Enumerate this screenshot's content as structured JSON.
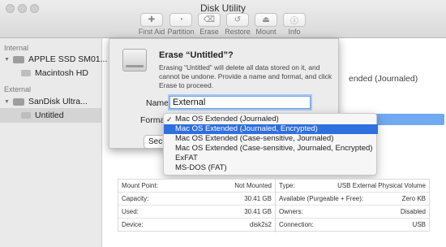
{
  "window": {
    "title": "Disk Utility"
  },
  "toolbar": [
    {
      "label": "First Aid",
      "icon": "first-aid-icon",
      "glyph": "✚"
    },
    {
      "label": "Partition",
      "icon": "partition-icon",
      "glyph": "◔"
    },
    {
      "label": "Erase",
      "icon": "erase-icon",
      "glyph": "⌫"
    },
    {
      "label": "Restore",
      "icon": "restore-icon",
      "glyph": "↺"
    },
    {
      "label": "Mount",
      "icon": "mount-icon",
      "glyph": "⏏"
    },
    {
      "label": "Info",
      "icon": "info-icon",
      "glyph": "ⓘ"
    }
  ],
  "sidebar": {
    "internal_header": "Internal",
    "external_header": "External",
    "items": [
      {
        "label": "APPLE SSD SM01..."
      },
      {
        "label": "Macintosh HD"
      },
      {
        "label": "SanDisk Ultra..."
      },
      {
        "label": "Untitled"
      }
    ]
  },
  "main": {
    "format_text": "ended (Journaled)"
  },
  "sheet": {
    "title": "Erase “Untitled”?",
    "message": "Erasing “Untitled” will delete all data stored on it, and cannot be undone. Provide a name and format, and click Erase to proceed.",
    "name_label": "Name:",
    "name_value": "External",
    "format_label": "Format",
    "security_button": "Security Options..."
  },
  "format_menu": {
    "options": [
      "Mac OS Extended (Journaled)",
      "Mac OS Extended (Journaled, Encrypted)",
      "Mac OS Extended (Case-sensitive, Journaled)",
      "Mac OS Extended (Case-sensitive, Journaled, Encrypted)",
      "ExFAT",
      "MS-DOS (FAT)"
    ],
    "checked": "✓",
    "accent": "#2f6fde"
  },
  "info": {
    "left": [
      {
        "label": "Mount Point:",
        "value": "Not Mounted"
      },
      {
        "label": "Capacity:",
        "value": "30.41 GB"
      },
      {
        "label": "Used:",
        "value": "30.41 GB"
      },
      {
        "label": "Device:",
        "value": "disk2s2"
      }
    ],
    "right": [
      {
        "label": "Type:",
        "value": "USB External Physical Volume"
      },
      {
        "label": "Available (Purgeable + Free):",
        "value": "Zero KB"
      },
      {
        "label": "Owners:",
        "value": "Disabled"
      },
      {
        "label": "Connection:",
        "value": "USB"
      }
    ]
  }
}
